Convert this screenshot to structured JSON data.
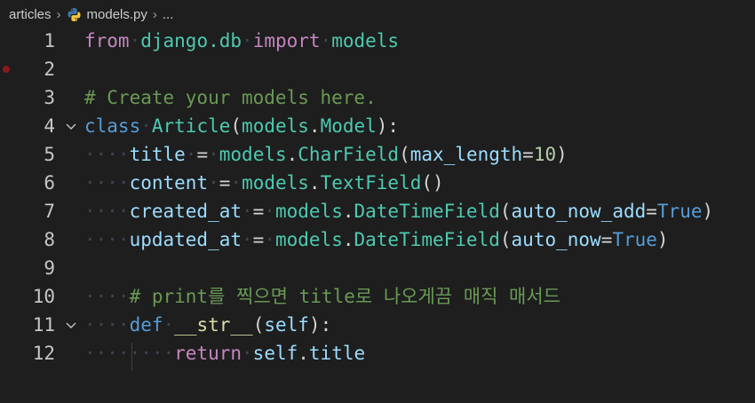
{
  "breadcrumb": {
    "folder": "articles",
    "file": "models.py",
    "tail": "..."
  },
  "code_lines": [
    {
      "num": "1"
    },
    {
      "num": "2"
    },
    {
      "num": "3"
    },
    {
      "num": "4"
    },
    {
      "num": "5"
    },
    {
      "num": "6"
    },
    {
      "num": "7"
    },
    {
      "num": "8"
    },
    {
      "num": "9"
    },
    {
      "num": "10"
    },
    {
      "num": "11"
    },
    {
      "num": "12"
    }
  ],
  "code": {
    "l1": {
      "kw_from": "from",
      "module": "django.db",
      "kw_import": "import",
      "name": "models"
    },
    "l3": {
      "comment": "# Create your models here."
    },
    "l4": {
      "kw_class": "class",
      "cls_name": "Article",
      "open": "(",
      "base_mod": "models",
      "dot": ".",
      "base_cls": "Model",
      "close": "):"
    },
    "l5": {
      "field": "title",
      "eq": "=",
      "mod": "models",
      "dot": ".",
      "type": "CharField",
      "open": "(",
      "arg": "max_length",
      "argeq": "=",
      "val": "10",
      "close": ")"
    },
    "l6": {
      "field": "content",
      "eq": "=",
      "mod": "models",
      "dot": ".",
      "type": "TextField",
      "parens": "()"
    },
    "l7": {
      "field": "created_at",
      "eq": "=",
      "mod": "models",
      "dot": ".",
      "type": "DateTimeField",
      "open": "(",
      "arg": "auto_now_add",
      "argeq": "=",
      "val": "True",
      "close": ")"
    },
    "l8": {
      "field": "updated_at",
      "eq": "=",
      "mod": "models",
      "dot": ".",
      "type": "DateTimeField",
      "open": "(",
      "arg": "auto_now",
      "argeq": "=",
      "val": "True",
      "close": ")"
    },
    "l10": {
      "comment": "# print를 찍으면 title로 나오게끔 매직 매서드"
    },
    "l11": {
      "kw_def": "def",
      "fn": "__str__",
      "open": "(",
      "param": "self",
      "close": "):"
    },
    "l12": {
      "kw_return": "return",
      "obj": "self",
      "dot": ".",
      "attr": "title"
    }
  },
  "colors": {
    "background": "#1e1e1e",
    "keyword": "#569cd6",
    "control_keyword": "#c586c0",
    "type": "#4ec9b0",
    "variable": "#9cdcfe",
    "function": "#dcdcaa",
    "number": "#b5cea8",
    "comment": "#6a9955",
    "breakpoint": "#8b1a1a"
  },
  "icons": {
    "python_file": "python-icon",
    "fold": "chevron-down-icon",
    "breakpoint": "breakpoint-dot-icon"
  }
}
